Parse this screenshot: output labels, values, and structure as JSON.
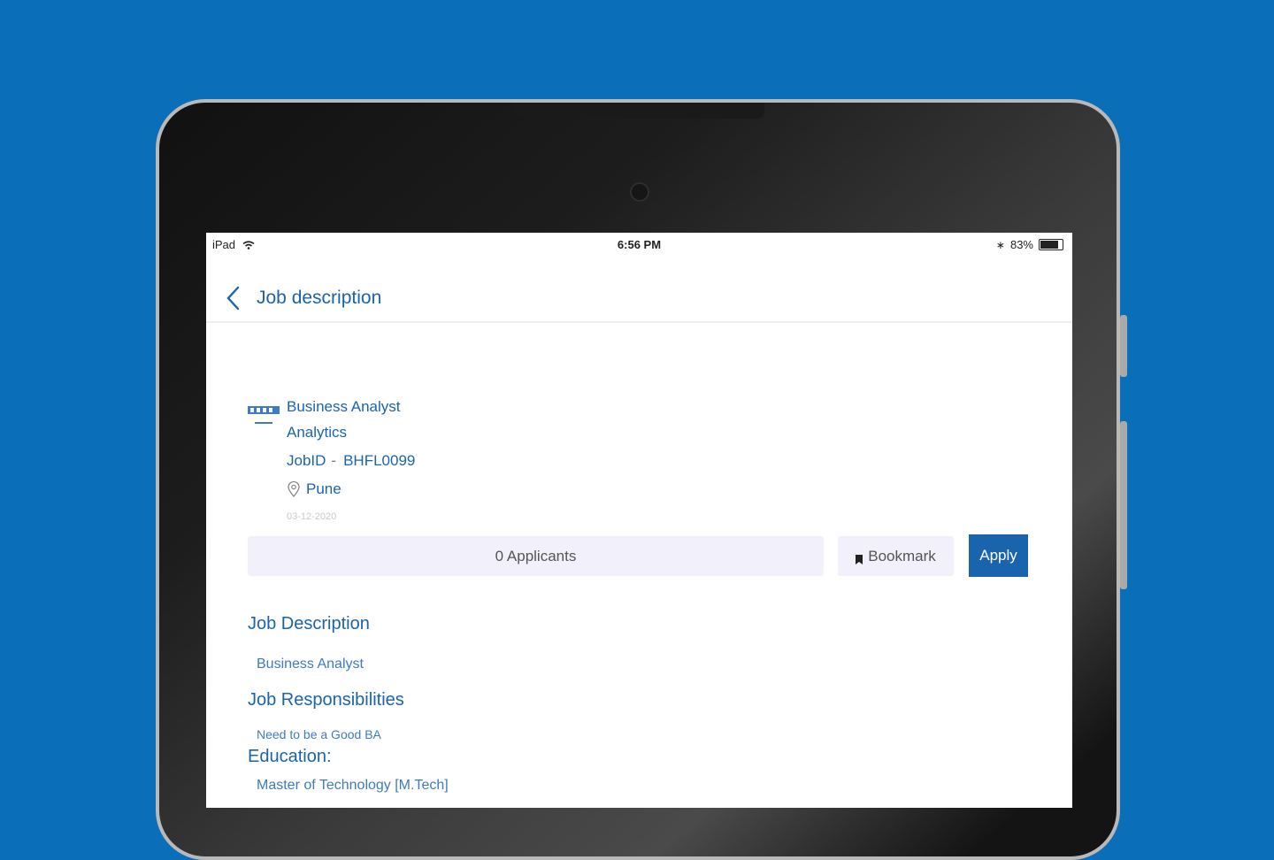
{
  "status_bar": {
    "device": "iPad",
    "time": "6:56 PM",
    "battery": "83%",
    "battery_level": 0.83
  },
  "nav": {
    "title": "Job description"
  },
  "job": {
    "title": "Business Analyst",
    "department": "Analytics",
    "id_label": "JobID",
    "id_separator": "-",
    "id_value": "BHFL0099",
    "location": "Pune",
    "date": "03-12-2020"
  },
  "actions": {
    "applicants": "0 Applicants",
    "bookmark": "Bookmark",
    "apply": "Apply"
  },
  "sections": {
    "description_heading": "Job Description",
    "description_body": "Business Analyst",
    "responsibilities_heading": "Job Responsibilities",
    "responsibilities_body": "Need to be a Good BA",
    "education_heading": "Education:",
    "education_body": "Master of Technology [M.Tech]"
  },
  "colors": {
    "background": "#0a6eb8",
    "accent": "#1a64ad",
    "applicants_bg": "#f2f1fb"
  }
}
